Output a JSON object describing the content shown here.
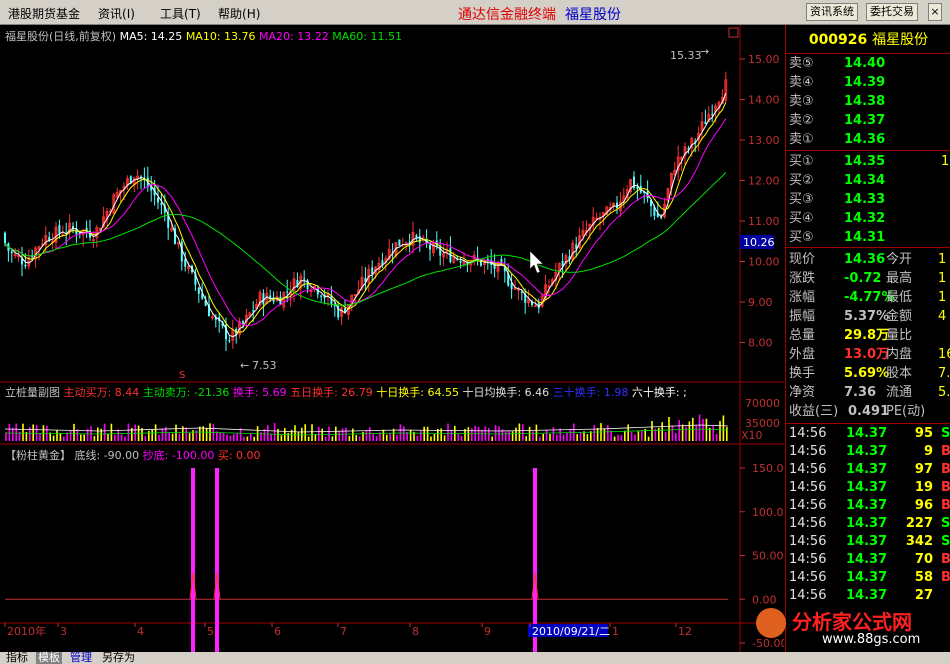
{
  "menu": {
    "items": [
      "港股期货基金",
      "资讯",
      "工具",
      "帮助",
      "指标"
    ],
    "hotkeys": [
      "",
      "(I)",
      "(T)",
      "(H)",
      ""
    ],
    "brand": "通达信金融终端",
    "stock_title": "福星股份",
    "btn_info": "资讯系统",
    "btn_trade": "委托交易",
    "ctrl_min": "_",
    "ctrl_max": "□",
    "ctrl_close": "×"
  },
  "main_chart": {
    "header_name": "福星股份(日线,前复权)",
    "ma5": "MA5: 14.25",
    "ma10": "MA10: 13.76",
    "ma20": "MA20: 13.22",
    "ma60": "MA60: 11.51",
    "high_label": "15.33",
    "low_label": "7.53",
    "current_price_tag": "10.26",
    "marker": "S",
    "y_ticks": [
      "15.00",
      "14.00",
      "13.00",
      "12.00",
      "11.00",
      "10.00",
      "9.00",
      "8.00"
    ],
    "colors": {
      "up": "#ff3232",
      "down": "#54ffff",
      "ma5": "#ffffff",
      "ma10": "#ffff00",
      "ma20": "#ff00ff",
      "ma60": "#00e000"
    }
  },
  "volume_panel": {
    "title": "立桩量副图",
    "main_buy": "主动买万: 8.44",
    "main_sell": "主动卖万: -21.36",
    "turnover": "换手: 5.69",
    "turnover5": "五日换手: 26.79",
    "turnover10": "十日换手: 64.55",
    "avg10": "十日均换手: 6.46",
    "turnover30": "三十换手: 1.98",
    "turnover60": "六十换手: ;",
    "y_ticks": [
      "70000",
      "35000"
    ],
    "unit": "X10"
  },
  "indicator_panel": {
    "title": "【粉柱黄金】",
    "base_line": "底线: -90.00",
    "bottom_fish": "抄底: -100.00",
    "buy": "买: 0.00",
    "y_ticks": [
      "150.00",
      "100.00",
      "50.00",
      "0.00",
      "-50.00"
    ]
  },
  "x_axis": {
    "labels": [
      "2010年",
      "3",
      "4",
      "5",
      "6",
      "7",
      "8",
      "9",
      "2010/09/21/二",
      "1",
      "12"
    ]
  },
  "quote": {
    "code": "000926",
    "name": "福星股份",
    "asks": [
      {
        "label": "卖⑤",
        "price": "14.40"
      },
      {
        "label": "卖④",
        "price": "14.39"
      },
      {
        "label": "卖③",
        "price": "14.38"
      },
      {
        "label": "卖②",
        "price": "14.37"
      },
      {
        "label": "卖①",
        "price": "14.36"
      }
    ],
    "bids": [
      {
        "label": "买①",
        "price": "14.35",
        "vol": "1"
      },
      {
        "label": "买②",
        "price": "14.34",
        "vol": ""
      },
      {
        "label": "买③",
        "price": "14.33",
        "vol": ""
      },
      {
        "label": "买④",
        "price": "14.32",
        "vol": ""
      },
      {
        "label": "买⑤",
        "price": "14.31",
        "vol": ""
      }
    ],
    "stats": [
      {
        "l1": "现价",
        "v1": "14.36",
        "l2": "今开",
        "v2": "1"
      },
      {
        "l1": "涨跌",
        "v1": "-0.72",
        "l2": "最高",
        "v2": "1"
      },
      {
        "l1": "涨幅",
        "v1": "-4.77%",
        "l2": "最低",
        "v2": "1"
      },
      {
        "l1": "振幅",
        "v1": "5.37%",
        "l2": "金额",
        "v2": "4"
      },
      {
        "l1": "总量",
        "v1": "29.8万",
        "l2": "量比",
        "v2": ""
      },
      {
        "l1": "外盘",
        "v1": "13.0万",
        "l2": "内盘",
        "v2": "16"
      },
      {
        "l1": "换手",
        "v1": "5.69%",
        "l2": "股本",
        "v2": "7."
      },
      {
        "l1": "净资",
        "v1": "7.36",
        "l2": "流通",
        "v2": "5.2"
      },
      {
        "l1": "收益(三)",
        "v1": "0.491",
        "l2": "PE(动)",
        "v2": ""
      }
    ],
    "ticks": [
      {
        "t": "14:56",
        "p": "14.37",
        "v": "95",
        "s": "S"
      },
      {
        "t": "14:56",
        "p": "14.37",
        "v": "9",
        "s": "B"
      },
      {
        "t": "14:56",
        "p": "14.37",
        "v": "97",
        "s": "B"
      },
      {
        "t": "14:56",
        "p": "14.37",
        "v": "19",
        "s": "B"
      },
      {
        "t": "14:56",
        "p": "14.37",
        "v": "96",
        "s": "B"
      },
      {
        "t": "14:56",
        "p": "14.37",
        "v": "227",
        "s": "S"
      },
      {
        "t": "14:56",
        "p": "14.37",
        "v": "342",
        "s": "S"
      },
      {
        "t": "14:56",
        "p": "14.37",
        "v": "70",
        "s": "B"
      },
      {
        "t": "14:56",
        "p": "14.37",
        "v": "58",
        "s": "B"
      },
      {
        "t": "14:56",
        "p": "14.37",
        "v": "27",
        "s": ""
      }
    ]
  },
  "bottom_tabs": [
    "指标",
    "模板",
    "管理",
    "另存为"
  ],
  "watermark": {
    "text": "分析家公式网",
    "url": "www.88gs.com"
  }
}
